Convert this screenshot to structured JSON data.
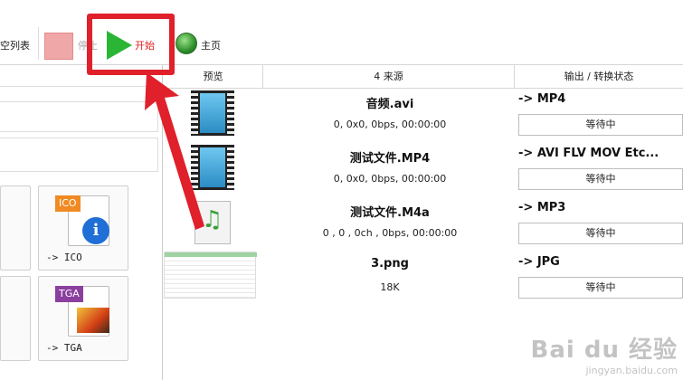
{
  "toolbar": {
    "clear_list_label": "空列表",
    "stop_label": "停止",
    "start_label": "开始",
    "home_label": "主页"
  },
  "table": {
    "headers": {
      "preview": "预览",
      "source": "4 来源",
      "output": "输出 / 转换状态"
    },
    "rows": [
      {
        "name": "音频.avi",
        "info": "0, 0x0, 0bps, 00:00:00",
        "target": "-> MP4",
        "status": "等待中",
        "thumb": "film-icon"
      },
      {
        "name": "测试文件.MP4",
        "info": "0, 0x0, 0bps, 00:00:00",
        "target": "-> AVI FLV MOV Etc...",
        "status": "等待中",
        "thumb": "film-icon"
      },
      {
        "name": "测试文件.M4a",
        "info": "0 , 0 , 0ch , 0bps, 00:00:00",
        "target": "-> MP3",
        "status": "等待中",
        "thumb": "music-file-icon"
      },
      {
        "name": "3.png",
        "info": "18K",
        "target": "-> JPG",
        "status": "等待中",
        "thumb": "spreadsheet-thumbnail"
      }
    ]
  },
  "formats": [
    {
      "badge": "ICO",
      "badge_color": "#f08a22",
      "label": "-> ICO"
    },
    {
      "badge": "TGA",
      "badge_color": "#8b3f9e",
      "label": "-> TGA"
    }
  ],
  "watermark": {
    "main": "Bai du 经验",
    "sub": "jingyan.baidu.com"
  },
  "colors": {
    "highlight": "#e0202a",
    "play": "#2bb535"
  }
}
